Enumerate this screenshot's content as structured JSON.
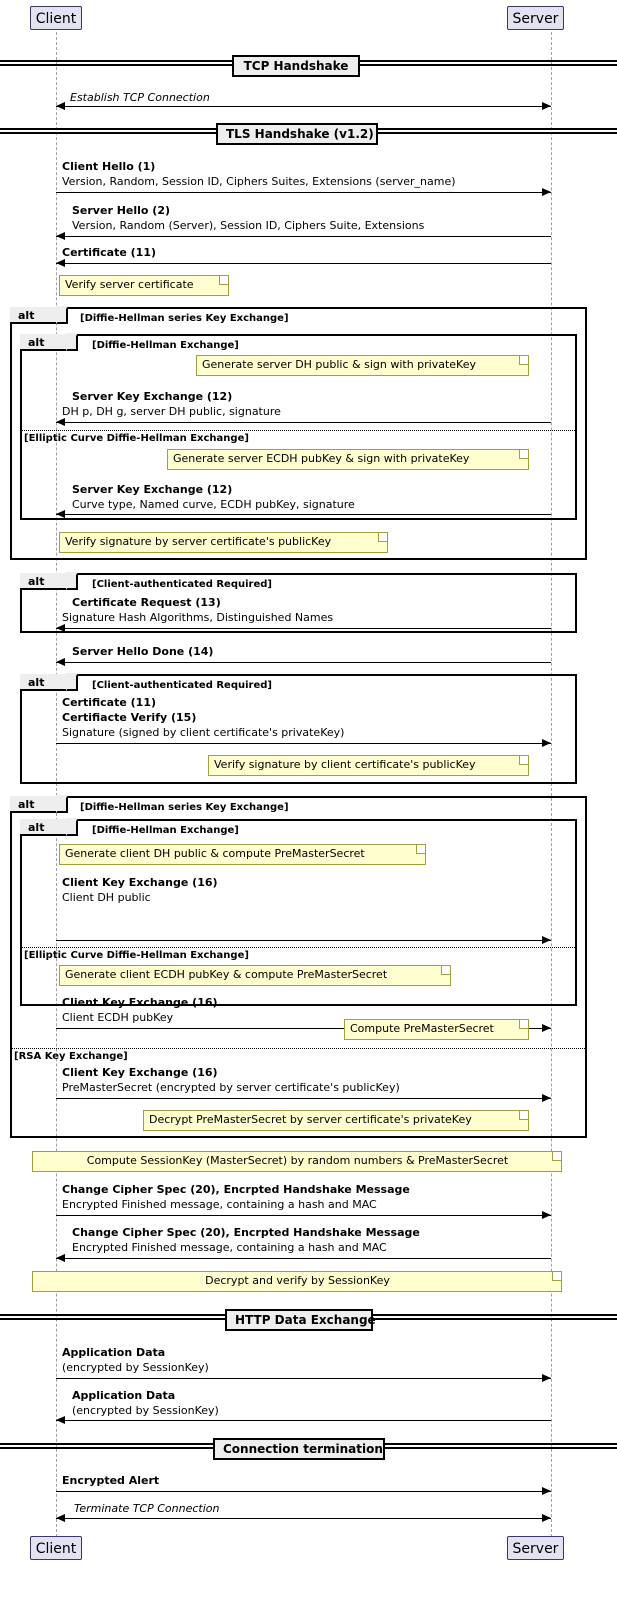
{
  "participants": {
    "client": "Client",
    "server": "Server"
  },
  "dividers": {
    "tcp_handshake": "TCP Handshake",
    "tls_handshake": "TLS Handshake (v1.2)",
    "http_data_exchange": "HTTP Data Exchange",
    "connection_termination": "Connection termination"
  },
  "messages": {
    "establish_tcp": "Establish TCP Connection",
    "client_hello_title": "Client Hello (1)",
    "client_hello_detail": "Version, Random, Session ID, Ciphers Suites, Extensions (server_name)",
    "server_hello_title": "Server Hello (2)",
    "server_hello_detail": "Version, Random (Server), Session ID, Ciphers Suite, Extensions",
    "certificate_11_a": "Certificate (11)",
    "server_key_exchange_dh_title": "Server Key Exchange (12)",
    "server_key_exchange_dh_detail": "DH p, DH g, server DH public, signature",
    "server_key_exchange_ecdh_title": "Server Key Exchange (12)",
    "server_key_exchange_ecdh_detail": "Curve type, Named curve, ECDH pubKey, signature",
    "certificate_request_title": "Certificate Request (13)",
    "certificate_request_detail": "Signature Hash Algorithms, Distinguished Names",
    "server_hello_done": "Server Hello Done (14)",
    "certificate_11_b": "Certificate (11)",
    "certificate_verify_title": "Certifiacte Verify (15)",
    "certificate_verify_detail": "Signature (signed by client certificate's privateKey)",
    "client_key_exchange_dh_title": "Client Key Exchange (16)",
    "client_key_exchange_dh_detail": "Client DH public",
    "client_key_exchange_ecdh_title": "Client Key Exchange (16)",
    "client_key_exchange_ecdh_detail": "Client ECDH pubKey",
    "client_key_exchange_rsa_title": "Client Key Exchange (16)",
    "client_key_exchange_rsa_detail": "PreMasterSecret (encrypted by server certificate's publicKey)",
    "change_cipher_spec_c2s_title": "Change Cipher Spec (20), Encrpted Handshake Message",
    "change_cipher_spec_c2s_detail": "Encrypted Finished message, containing a hash and MAC",
    "change_cipher_spec_s2c_title": "Change Cipher Spec (20), Encrpted Handshake Message",
    "change_cipher_spec_s2c_detail": "Encrypted Finished message, containing a hash and MAC",
    "app_data_c2s_title": "Application Data",
    "app_data_c2s_detail": "(encrypted by SessionKey)",
    "app_data_s2c_title": "Application Data",
    "app_data_s2c_detail": "(encrypted by SessionKey)",
    "encrypted_alert": "Encrypted Alert",
    "terminate_tcp": "Terminate TCP Connection"
  },
  "notes": {
    "verify_server_certificate": "Verify server certificate",
    "generate_server_dh": "Generate server DH public & sign with privateKey",
    "generate_server_ecdh": "Generate server ECDH pubKey & sign with privateKey",
    "verify_signature_server_pub": "Verify signature by server certificate's publicKey",
    "verify_signature_client_pub": "Verify signature by client certificate's publicKey",
    "generate_client_dh": "Generate client DH public & compute PreMasterSecret",
    "generate_client_ecdh": "Generate client ECDH pubKey & compute PreMasterSecret",
    "compute_premastersecret": "Compute PreMasterSecret",
    "decrypt_premastersecret": "Decrypt PreMasterSecret by server certificate's privateKey",
    "compute_sessionkey": "Compute SessionKey (MasterSecret) by random numbers & PreMasterSecret",
    "decrypt_verify_sessionkey": "Decrypt and verify by SessionKey"
  },
  "groups": {
    "alt_keyword": "alt",
    "dh_series_1": "[Diffie-Hellman series Key Exchange]",
    "dh_exchange_1": "[Diffie-Hellman Exchange]",
    "ecdh_else_1": "[Elliptic Curve Diffie-Hellman Exchange]",
    "client_auth_1": "[Client-authenticated Required]",
    "client_auth_2": "[Client-authenticated Required]",
    "dh_series_2": "[Diffie-Hellman series Key Exchange]",
    "dh_exchange_2": "[Diffie-Hellman Exchange]",
    "ecdh_else_2": "[Elliptic Curve Diffie-Hellman Exchange]",
    "rsa_else": "[RSA Key Exchange]"
  },
  "colors": {
    "participant_fill": "#E2E2F0",
    "participant_border": "#383868",
    "note_fill": "#FEFECE",
    "note_border": "#A0A040",
    "group_tab_fill": "#EEEEEE",
    "lifeline": "#A0A0A0"
  }
}
